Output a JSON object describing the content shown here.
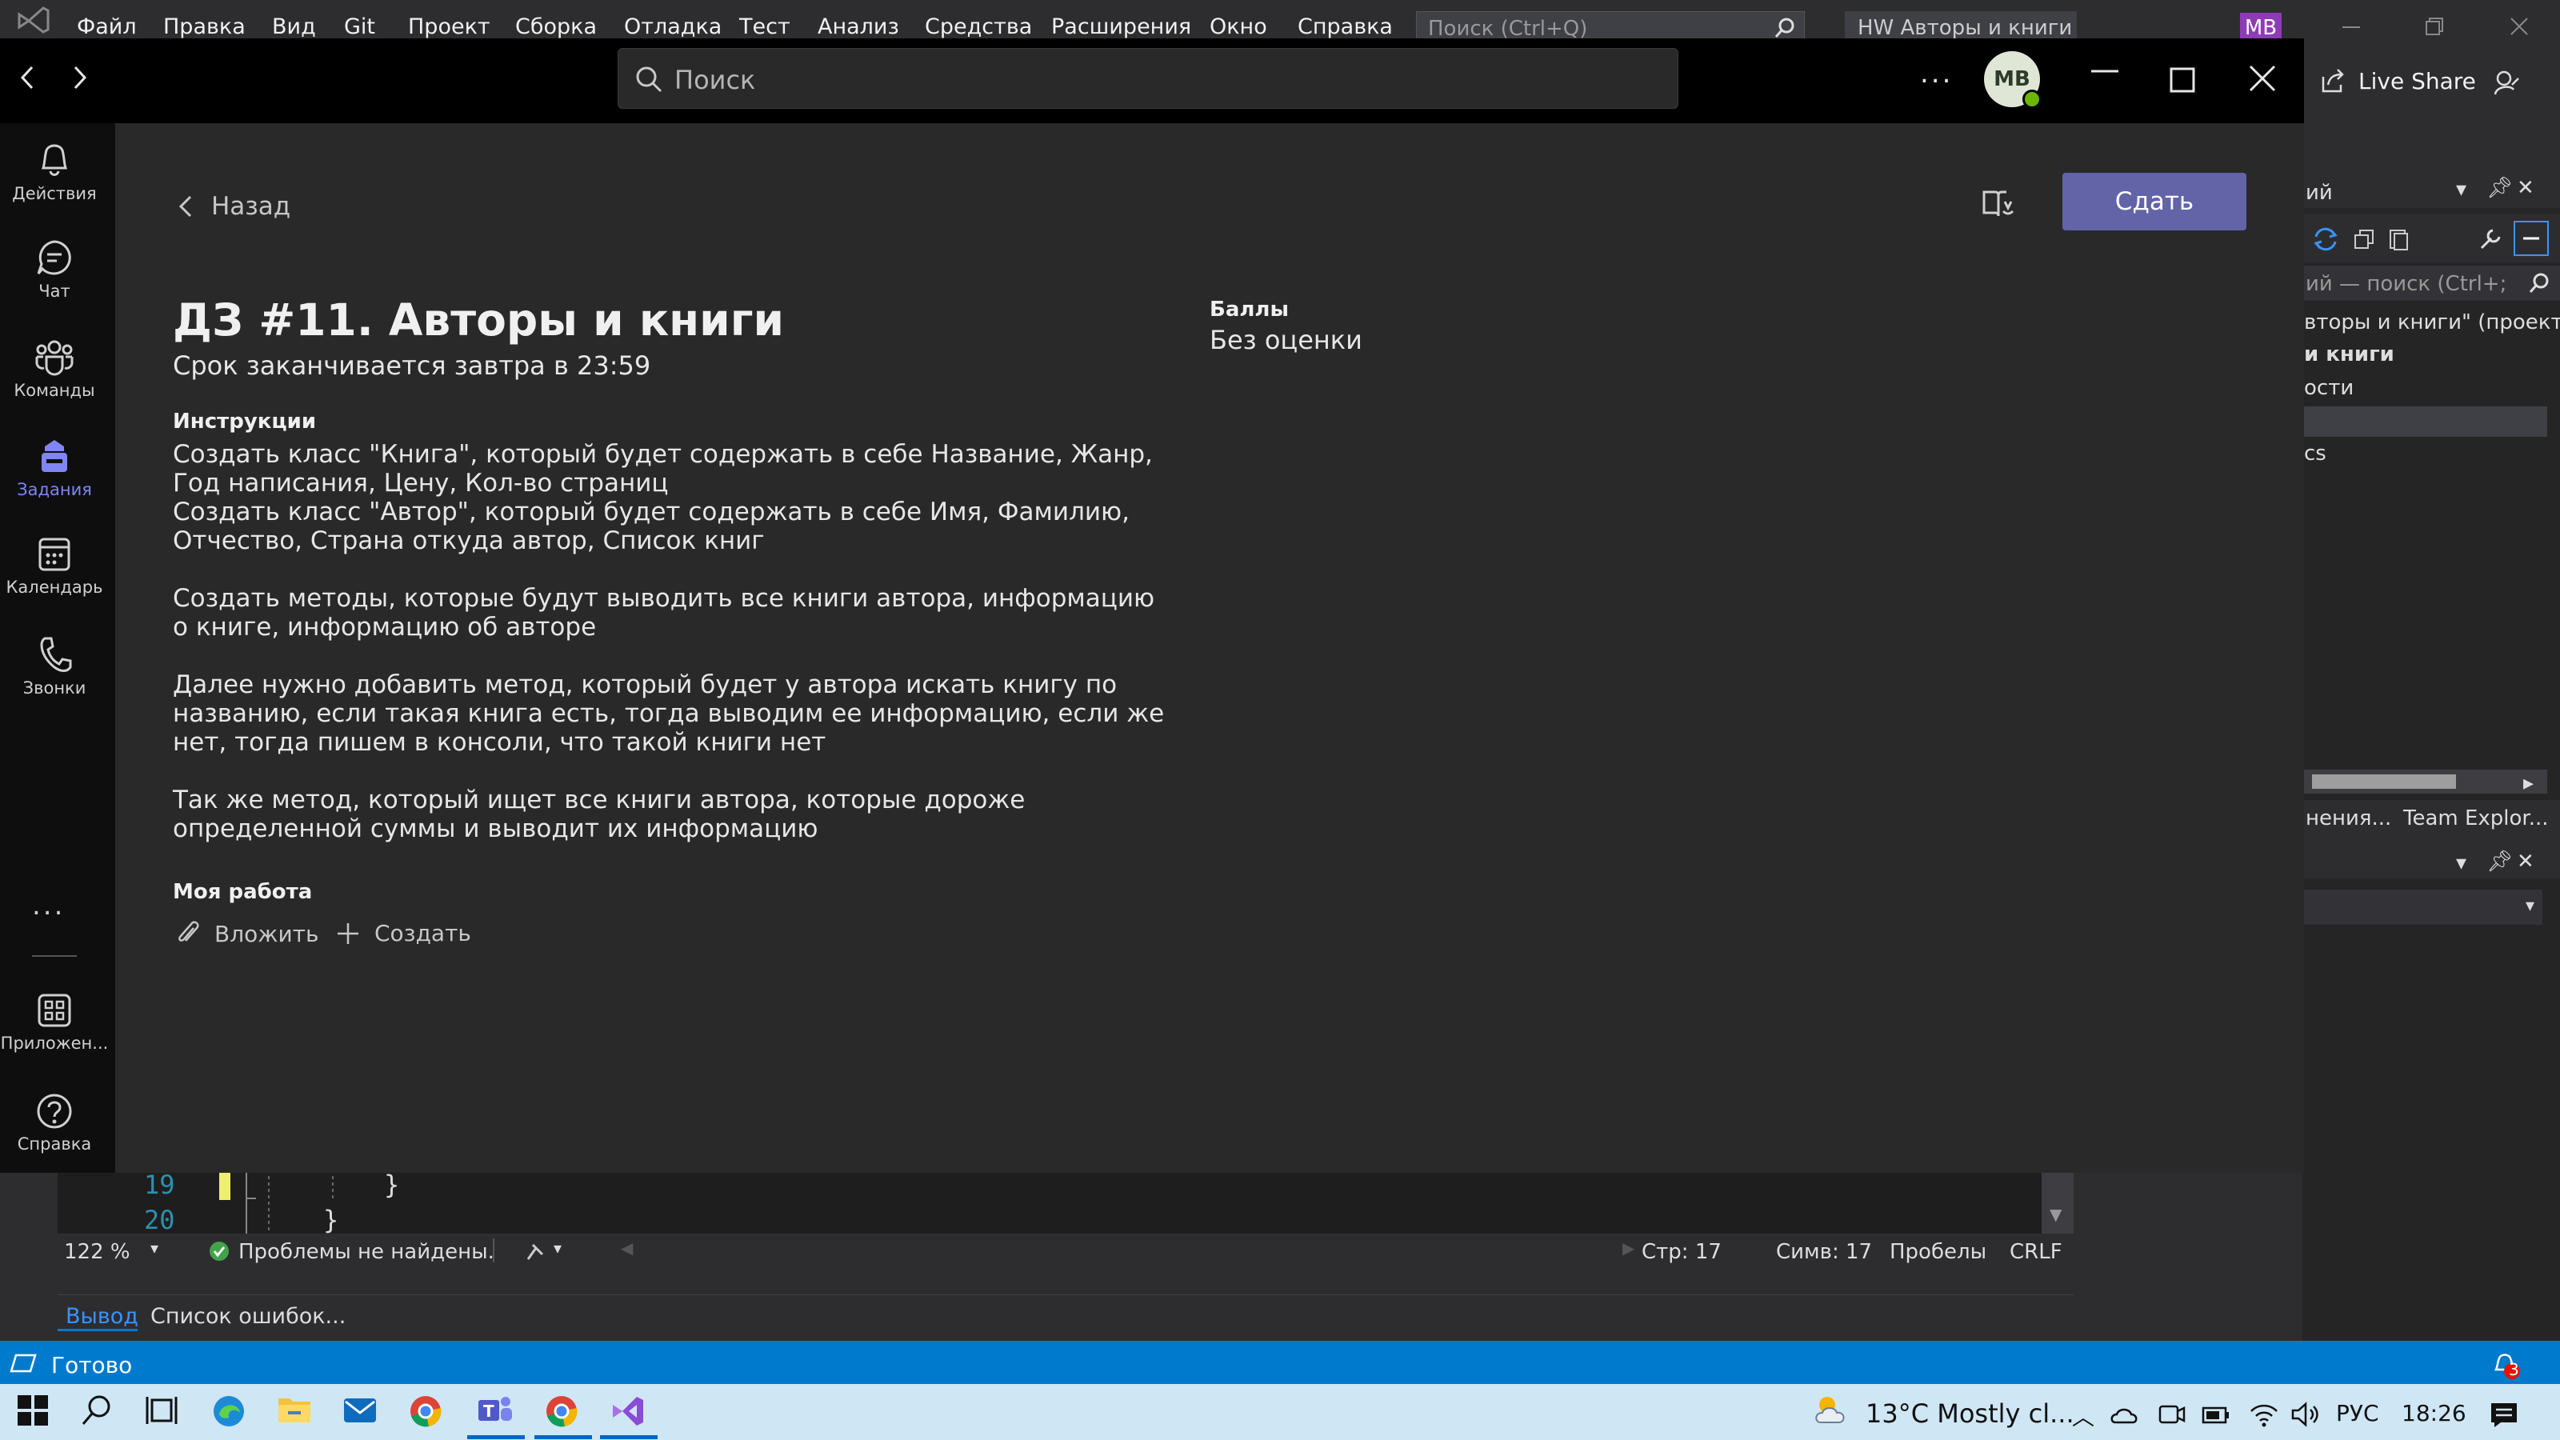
{
  "vs": {
    "menu": [
      "Файл",
      "Правка",
      "Вид",
      "Git",
      "Проект",
      "Сборка",
      "Отладка",
      "Тест",
      "Анализ",
      "Средства",
      "Расширения",
      "Окно",
      "Справка"
    ],
    "search_placeholder": "Поиск (Ctrl+Q)",
    "solution_title": "HW Авторы и книги",
    "user_initials": "МВ",
    "live_share": "Live Share",
    "solution_explorer": {
      "title_fragment": "ий",
      "search_fragment": "ий — поиск (Ctrl+;",
      "lines": [
        "вторы и книги\" (проекть",
        "и книги",
        "ости",
        "",
        "cs"
      ],
      "tabs": [
        "нения...",
        "Team Explor..."
      ]
    },
    "editor": {
      "line_numbers": [
        "19",
        "20"
      ],
      "code_lines": [
        "}",
        "}"
      ],
      "zoom": "122 %",
      "issues": "Проблемы не найдены.",
      "line": "Стр: 17",
      "char": "Симв: 17",
      "spaces": "Пробелы",
      "eol": "CRLF"
    },
    "output_tab": "Вывод",
    "errors_tab": "Список ошибок...",
    "status": "Готово",
    "notifications_count": "3"
  },
  "teams": {
    "search_placeholder": "Поиск",
    "user_initials": "МВ",
    "more_label": "...",
    "rail": [
      {
        "label": "Действия",
        "icon": "bell-icon"
      },
      {
        "label": "Чат",
        "icon": "chat-icon"
      },
      {
        "label": "Команды",
        "icon": "teams-icon"
      },
      {
        "label": "Задания",
        "icon": "assignments-icon"
      },
      {
        "label": "Календарь",
        "icon": "calendar-icon"
      },
      {
        "label": "Звонки",
        "icon": "phone-icon"
      },
      {
        "label": "Приложен...",
        "icon": "apps-icon"
      },
      {
        "label": "Справка",
        "icon": "help-icon"
      }
    ],
    "rail_more": "...",
    "back_label": "Назад",
    "submit_label": "Сдать",
    "assignment": {
      "title": "ДЗ #11. Авторы и книги",
      "due": "Срок заканчивается завтра в 23:59",
      "instructions_heading": "Инструкции",
      "instructions": [
        "Создать класс \"Книга\", который будет содержать в себе Название, Жанр, Год написания, Цену, Кол-во страниц",
        "Создать класс \"Автор\", который будет содержать в себе Имя, Фамилию, Отчество, Страна откуда автор, Список книг",
        "Создать методы, которые будут выводить все книги автора, информацию о книге, информацию об авторе",
        "Далее нужно добавить метод, который будет у автора искать книгу по названию, если такая книга есть, тогда выводим ее информацию, если же нет, тогда пишем в консоли, что такой книги нет",
        "Так же метод, который ищет все книги автора, которые дороже определенной суммы и выводит их информацию"
      ],
      "my_work_heading": "Моя работа",
      "attach_label": "Вложить",
      "create_label": "Создать",
      "points_label": "Баллы",
      "points_value": "Без оценки"
    },
    "accent_color": "#6264a7"
  },
  "taskbar": {
    "temperature": "13°C",
    "weather": "Mostly cl...",
    "language": "РУС",
    "time": "18:26"
  }
}
